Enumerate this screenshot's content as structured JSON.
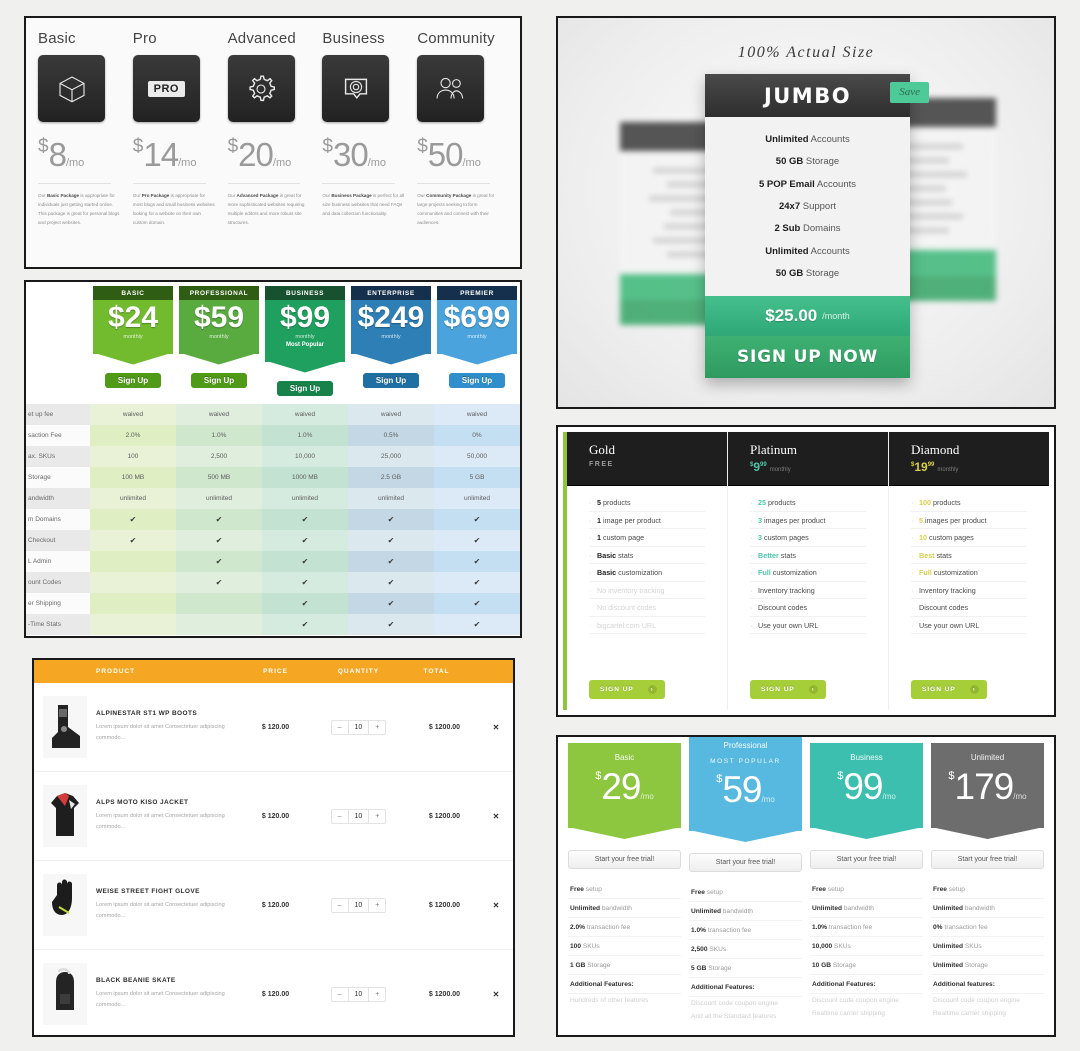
{
  "panel1": {
    "name": "icon-pricing-table",
    "plans": [
      {
        "name": "Basic",
        "icon": "cube-icon",
        "currency": "$",
        "amount": "8",
        "period": "/mo",
        "desc_lead": "Our ",
        "desc_bold": "Basic Package",
        "desc_rest": " is appropriate for individuals just getting started online. This package is great for personal blogs and project websites."
      },
      {
        "name": "Pro",
        "icon": "pro-badge-icon",
        "currency": "$",
        "amount": "14",
        "period": "/mo",
        "desc_lead": "Our ",
        "desc_bold": "Pro Package",
        "desc_rest": " is appropriate for most blogs and small business websites looking for a website on their own custom domain."
      },
      {
        "name": "Advanced",
        "icon": "gear-icon",
        "currency": "$",
        "amount": "20",
        "period": "/mo",
        "desc_lead": "Our ",
        "desc_bold": "Advanced Package",
        "desc_rest": " is great for more sophisticated websites requiring multiple editors and more robust site structures."
      },
      {
        "name": "Business",
        "icon": "speech-bubble-icon",
        "currency": "$",
        "amount": "30",
        "period": "/mo",
        "desc_lead": "Our ",
        "desc_bold": "Business Package",
        "desc_rest": " is perfect for all size business websites that need FAQs and data collection functionality."
      },
      {
        "name": "Community",
        "icon": "people-icon",
        "currency": "$",
        "amount": "50",
        "period": "/mo",
        "desc_lead": "Our ",
        "desc_bold": "Community Package",
        "desc_rest": " is great for large projects seeking to form communities and connect with their audiences."
      }
    ],
    "pro_badge_text": "PRO"
  },
  "panel2": {
    "name": "comparison-pricing-grid",
    "signup_label": "Sign Up",
    "monthly_label": "monthly",
    "most_popular": "Most Popular",
    "columns": [
      {
        "cap": "BASIC",
        "price": "$24",
        "popular": "",
        "cap_bg": "#2f5d14",
        "card_bg": "#72bb2f",
        "btn_bg": "#4f9a16"
      },
      {
        "cap": "PROFESSIONAL",
        "price": "$59",
        "popular": "",
        "cap_bg": "#2f5d14",
        "card_bg": "#59ab3f",
        "btn_bg": "#4f9a16"
      },
      {
        "cap": "BUSINESS",
        "price": "$99",
        "popular": "Most Popular",
        "cap_bg": "#18512f",
        "card_bg": "#20a05e",
        "btn_bg": "#17834b"
      },
      {
        "cap": "ENTERPRISE",
        "price": "$249",
        "popular": "",
        "cap_bg": "#14304d",
        "card_bg": "#2d7fb5",
        "btn_bg": "#1f6fa2"
      },
      {
        "cap": "PREMIER",
        "price": "$699",
        "popular": "",
        "cap_bg": "#14304d",
        "card_bg": "#4aa3dd",
        "btn_bg": "#2f8ecb"
      }
    ],
    "check_glyph": "✔",
    "rows": [
      {
        "label": "et up fee",
        "values": [
          "waived",
          "waived",
          "waived",
          "waived",
          "waived"
        ]
      },
      {
        "label": "saction Fee",
        "values": [
          "2.0%",
          "1.0%",
          "1.0%",
          "0.5%",
          "0%"
        ]
      },
      {
        "label": "ax. SKUs",
        "values": [
          "100",
          "2,500",
          "10,000",
          "25,000",
          "50,000"
        ]
      },
      {
        "label": "Storage",
        "values": [
          "100 MB",
          "500 MB",
          "1000 MB",
          "2.5 GB",
          "5 GB"
        ]
      },
      {
        "label": "andwidth",
        "values": [
          "unlimited",
          "unlimited",
          "unlimited",
          "unlimited",
          "unlimited"
        ]
      },
      {
        "label": "m Domains",
        "values": [
          "✔",
          "✔",
          "✔",
          "✔",
          "✔"
        ]
      },
      {
        "label": "Checkout",
        "values": [
          "✔",
          "✔",
          "✔",
          "✔",
          "✔"
        ]
      },
      {
        "label": "L Admin",
        "values": [
          "",
          "✔",
          "✔",
          "✔",
          "✔"
        ]
      },
      {
        "label": "ount Codes",
        "values": [
          "",
          "✔",
          "✔",
          "✔",
          "✔"
        ]
      },
      {
        "label": "er Shipping",
        "values": [
          "",
          "",
          "✔",
          "✔",
          "✔"
        ]
      },
      {
        "label": "-Time Stats",
        "values": [
          "",
          "",
          "✔",
          "✔",
          "✔"
        ]
      }
    ]
  },
  "panel3": {
    "name": "shopping-cart-table",
    "headers": {
      "product": "PRODUCT",
      "price": "PRICE",
      "quantity": "QUANTITY",
      "total": "TOTAL"
    },
    "minus": "–",
    "plus": "+",
    "remove": "✕",
    "items": [
      {
        "title": "ALPINESTAR ST1 WP BOOTS",
        "desc": "Lorem ipsum dolor sit amet Consectetuer adipiscing commodo...",
        "price": "$ 120.00",
        "qty": "10",
        "total": "$ 1200.00",
        "thumb": "boot-thumbnail"
      },
      {
        "title": "ALPS MOTO KISO JACKET",
        "desc": "Lorem ipsum dolor sit amet Consectetuer adipiscing commodo...",
        "price": "$ 120.00",
        "qty": "10",
        "total": "$ 1200.00",
        "thumb": "jacket-thumbnail"
      },
      {
        "title": "WEISE STREET FIGHT GLOVE",
        "desc": "Lorem ipsum dolor sit amet Consectetuer adipiscing commodo...",
        "price": "$ 120.00",
        "qty": "10",
        "total": "$ 1200.00",
        "thumb": "glove-thumbnail"
      },
      {
        "title": "BLACK BEANIE SKATE",
        "desc": "Lorem ipsum dolor sit amet Consectetuer adipiscing commodo...",
        "price": "$ 120.00",
        "qty": "10",
        "total": "$ 1200.00",
        "thumb": "backpack-thumbnail"
      }
    ]
  },
  "panel4": {
    "name": "jumbo-plan-callout",
    "actual_size_note": "100% Actual Size",
    "title": "JUMBO",
    "save_badge": "Save",
    "features": [
      {
        "b": "Unlimited",
        "t": " Accounts"
      },
      {
        "b": "50 GB",
        "t": " Storage"
      },
      {
        "b": "5 POP Email",
        "t": " Accounts"
      },
      {
        "b": "24x7",
        "t": " Support"
      },
      {
        "b": "2 Sub",
        "t": " Domains"
      },
      {
        "b": "Unlimited",
        "t": " Accounts"
      },
      {
        "b": "50 GB",
        "t": " Storage"
      }
    ],
    "price": "$25.00",
    "period": "/month",
    "cta": "SIGN UP NOW"
  },
  "panel5": {
    "name": "gold-platinum-diamond-table",
    "signup_label": "SIGN UP",
    "arrow_glyph": "›",
    "columns": [
      {
        "name": "Gold",
        "sub": "FREE",
        "price_cur": "",
        "price_big": "",
        "price_cents": "",
        "period": "",
        "accent": "#ffffff",
        "items": [
          {
            "b": "5",
            "t": " products",
            "off": false
          },
          {
            "b": "1",
            "t": " image per product",
            "off": false
          },
          {
            "b": "1",
            "t": " custom page",
            "off": false
          },
          {
            "b": "Basic",
            "t": " stats",
            "off": false
          },
          {
            "b": "Basic",
            "t": " customization",
            "off": false
          },
          {
            "b": "",
            "t": "No inventory tracking",
            "off": true
          },
          {
            "b": "",
            "t": "No discount codes",
            "off": true
          },
          {
            "b": "",
            "t": "bigcartel.com URL",
            "off": true
          }
        ]
      },
      {
        "name": "Platinum",
        "sub": "",
        "price_cur": "$",
        "price_big": "9",
        "price_cents": "99",
        "period": "monthly",
        "accent": "#4ec6a8",
        "items": [
          {
            "b": "25",
            "t": " products",
            "off": false
          },
          {
            "b": "3",
            "t": " images per product",
            "off": false
          },
          {
            "b": "3",
            "t": " custom pages",
            "off": false
          },
          {
            "b": "Better",
            "t": " stats",
            "off": false
          },
          {
            "b": "Full",
            "t": " customization",
            "off": false
          },
          {
            "b": "",
            "t": "Inventory tracking",
            "off": false
          },
          {
            "b": "",
            "t": "Discount codes",
            "off": false
          },
          {
            "b": "",
            "t": "Use your own URL",
            "off": false
          }
        ]
      },
      {
        "name": "Diamond",
        "sub": "",
        "price_cur": "$",
        "price_big": "19",
        "price_cents": "99",
        "period": "monthly",
        "accent": "#d8cf4a",
        "items": [
          {
            "b": "100",
            "t": " products",
            "off": false
          },
          {
            "b": "5",
            "t": " images per product",
            "off": false
          },
          {
            "b": "10",
            "t": " custom pages",
            "off": false
          },
          {
            "b": "Best",
            "t": " stats",
            "off": false
          },
          {
            "b": "Full",
            "t": " customization",
            "off": false
          },
          {
            "b": "",
            "t": "Inventory tracking",
            "off": false
          },
          {
            "b": "",
            "t": "Discount codes",
            "off": false
          },
          {
            "b": "",
            "t": "Use your own URL",
            "off": false
          }
        ]
      }
    ]
  },
  "panel6": {
    "name": "basic-pro-business-unlimited-table",
    "trial_label": "Start your free trial!",
    "most_popular": "MOST POPULAR",
    "columns": [
      {
        "name": "Basic",
        "popular": "",
        "cur": "$",
        "amount": "29",
        "per": "/mo",
        "bg": "#8dc63f",
        "feats": [
          {
            "b": "Free",
            "t": " setup"
          },
          {
            "b": "Unlimited",
            "t": " bandwidth"
          },
          {
            "b": "2.0%",
            "t": " transaction fee"
          },
          {
            "b": "100",
            "t": " SKUs"
          },
          {
            "b": "1 GB",
            "t": " Storage"
          },
          {
            "b": "Additional Features:",
            "t": ""
          }
        ],
        "faint": [
          "Hundreds of other features"
        ]
      },
      {
        "name": "Professional",
        "popular": "MOST POPULAR",
        "cur": "$",
        "amount": "59",
        "per": "/mo",
        "bg": "#58b9e0",
        "feats": [
          {
            "b": "Free",
            "t": " setup"
          },
          {
            "b": "Unlimited",
            "t": " bandwidth"
          },
          {
            "b": "1.0%",
            "t": " transaction fee"
          },
          {
            "b": "2,500",
            "t": " SKUs"
          },
          {
            "b": "5 GB",
            "t": " Storage"
          },
          {
            "b": "Additional Features:",
            "t": ""
          }
        ],
        "faint": [
          "Discount code coupon engine",
          "And all the Standard features"
        ]
      },
      {
        "name": "Business",
        "popular": "",
        "cur": "$",
        "amount": "99",
        "per": "/mo",
        "bg": "#3cbfae",
        "feats": [
          {
            "b": "Free",
            "t": " setup"
          },
          {
            "b": "Unlimited",
            "t": " bandwidth"
          },
          {
            "b": "1.0%",
            "t": " transaction fee"
          },
          {
            "b": "10,000",
            "t": " SKUs"
          },
          {
            "b": "10 GB",
            "t": " Storage"
          },
          {
            "b": "Additional Features:",
            "t": ""
          }
        ],
        "faint": [
          "Discount code coupon engine",
          "Realtime carrier shipping"
        ]
      },
      {
        "name": "Unlimited",
        "popular": "",
        "cur": "$",
        "amount": "179",
        "per": "/mo",
        "bg": "#6d6d6d",
        "feats": [
          {
            "b": "Free",
            "t": " setup"
          },
          {
            "b": "Unlimited",
            "t": " bandwidth"
          },
          {
            "b": "0%",
            "t": " transaction fee"
          },
          {
            "b": "Unlimited",
            "t": " SKUs"
          },
          {
            "b": "Unlimited",
            "t": " Storage"
          },
          {
            "b": "Additional features:",
            "t": ""
          }
        ],
        "faint": [
          "Discount code coupon engine",
          "Realtime carrier shipping"
        ]
      }
    ]
  }
}
